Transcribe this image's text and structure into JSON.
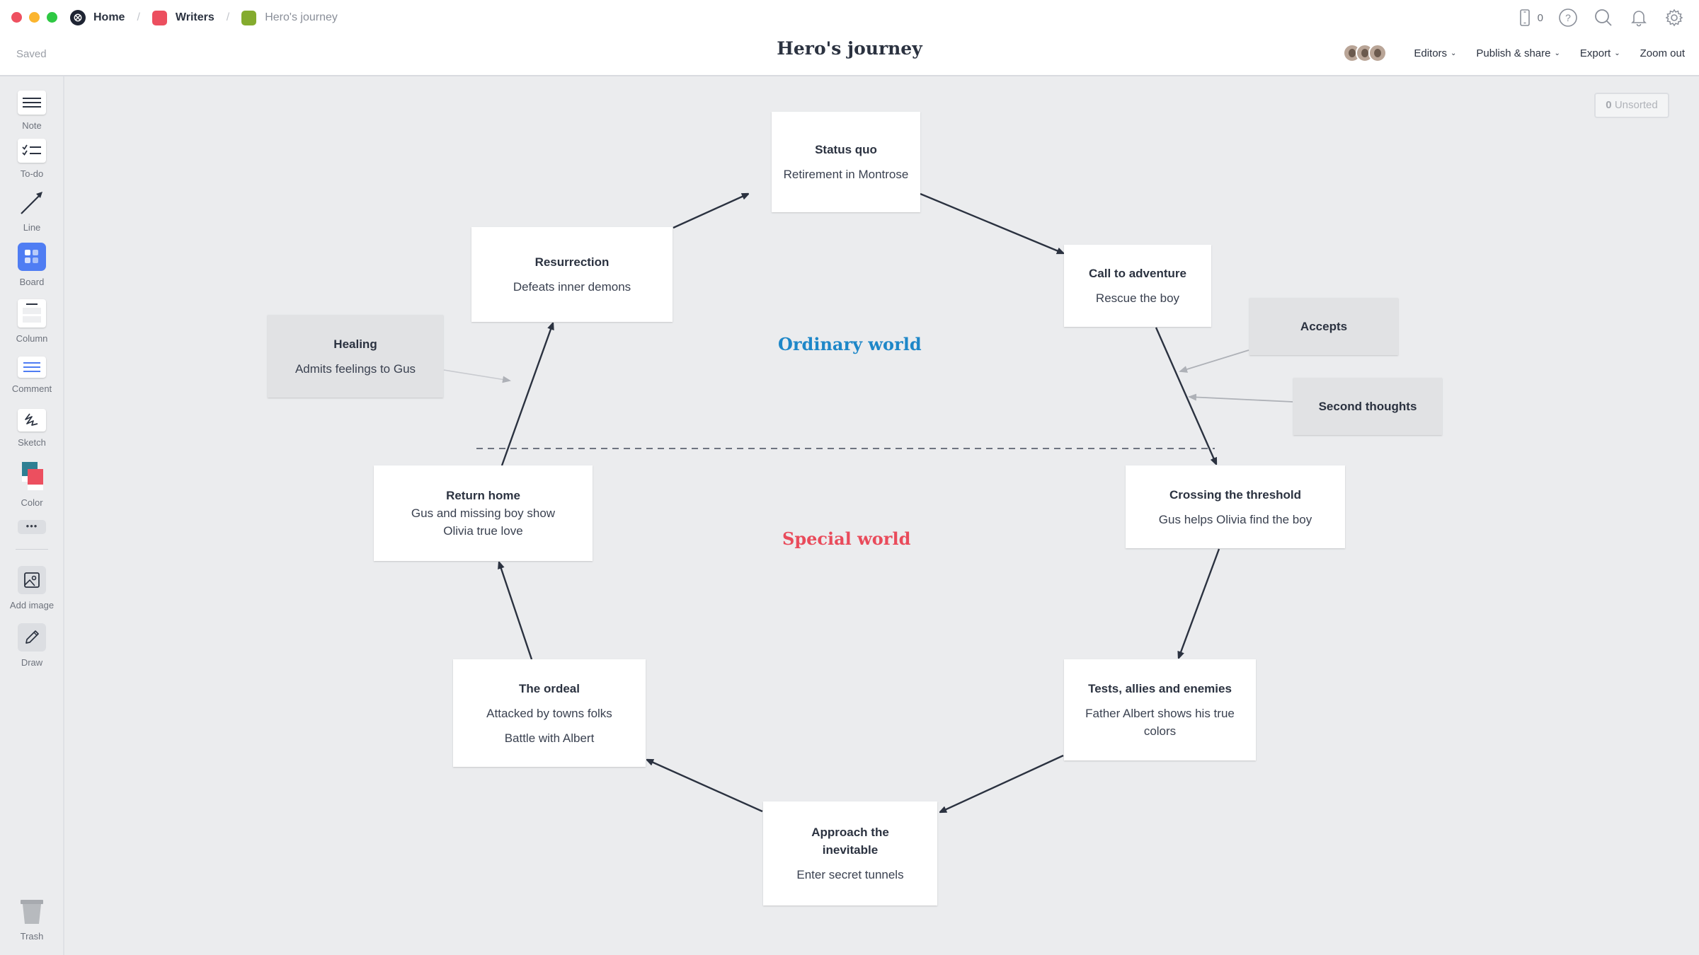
{
  "window": {
    "breadcrumb": [
      {
        "label": "Home",
        "icon": "milanote-logo-icon",
        "color": "#1e2433"
      },
      {
        "label": "Writers",
        "icon": "board-color-icon",
        "color": "#ec4f5f"
      },
      {
        "label": "Hero's journey",
        "icon": "board-color-icon",
        "color": "#84ab2e"
      }
    ],
    "separator": "/",
    "save_status": "Saved",
    "title": "Hero's journey",
    "mobile_count": "0",
    "actions": {
      "editors": "Editors",
      "publish": "Publish & share",
      "export": "Export",
      "zoom": "Zoom out"
    }
  },
  "toolbar": {
    "items": [
      {
        "label": "Note",
        "icon": "note-icon"
      },
      {
        "label": "To-do",
        "icon": "todo-icon"
      },
      {
        "label": "Line",
        "icon": "line-arrow-icon"
      },
      {
        "label": "Board",
        "icon": "board-icon"
      },
      {
        "label": "Column",
        "icon": "column-icon"
      },
      {
        "label": "Comment",
        "icon": "comment-icon"
      },
      {
        "label": "Sketch",
        "icon": "sketch-icon"
      },
      {
        "label": "Color",
        "icon": "color-swatch-icon"
      },
      {
        "label": "",
        "icon": "more-icon"
      },
      {
        "label": "Add image",
        "icon": "image-icon"
      },
      {
        "label": "Draw",
        "icon": "pencil-icon"
      },
      {
        "label": "Trash",
        "icon": "trash-icon"
      }
    ]
  },
  "canvas": {
    "unsorted": {
      "count": "0",
      "label": "Unsorted"
    },
    "headings": {
      "ordinary": {
        "text": "Ordinary world",
        "color": "#1e87c8"
      },
      "special": {
        "text": "Special world",
        "color": "#e94b5b"
      }
    },
    "cards": {
      "status_quo": {
        "title": "Status quo",
        "body": [
          "Retirement in Montrose"
        ]
      },
      "call": {
        "title": "Call to adventure",
        "body": [
          "Rescue the boy"
        ]
      },
      "accepts": {
        "title": "Accepts",
        "body": []
      },
      "second": {
        "title": "Second thoughts",
        "body": []
      },
      "crossing": {
        "title": "Crossing the threshold",
        "body": [
          "Gus helps Olivia find the boy"
        ]
      },
      "tests": {
        "title": "Tests, allies and enemies",
        "body": [
          "Father Albert shows his true colors"
        ]
      },
      "approach": {
        "title": "Approach the inevitable",
        "body": [
          "Enter secret tunnels"
        ]
      },
      "ordeal": {
        "title": "The ordeal",
        "body": [
          "Attacked by towns folks",
          "Battle with Albert"
        ]
      },
      "return": {
        "title": "Return home",
        "body": [
          "Gus and missing boy show Olivia true love"
        ]
      },
      "resurrection": {
        "title": "Resurrection",
        "body": [
          "Defeats inner demons"
        ]
      },
      "healing": {
        "title": "Healing",
        "body": [
          "Admits feelings to Gus"
        ]
      }
    }
  }
}
